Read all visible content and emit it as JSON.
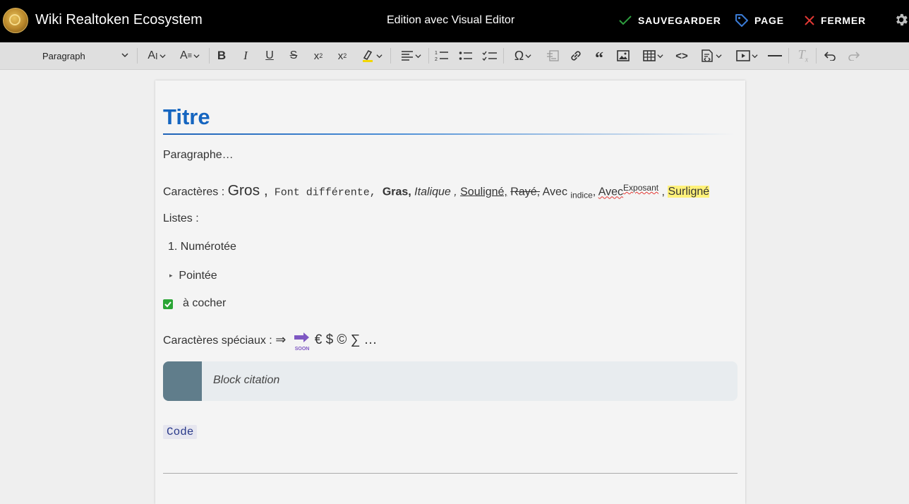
{
  "header": {
    "app_title": "Wiki Realtoken Ecosystem",
    "center_title": "Edition avec Visual Editor",
    "save_label": "SAUVEGARDER",
    "page_label": "PAGE",
    "close_label": "FERMER",
    "colors": {
      "bg": "#000000",
      "save_icon": "#2e9e3f",
      "page_icon": "#3a7bd5",
      "close_icon": "#e53935"
    }
  },
  "toolbar": {
    "paragraph_select": "Paragraph",
    "buttons": [
      "font-size",
      "text-style",
      "bold",
      "italic",
      "underline",
      "strikethrough",
      "subscript",
      "superscript",
      "highlight",
      "align",
      "ordered-list",
      "bullet-list",
      "task-list",
      "special-char",
      "template",
      "link",
      "blockquote",
      "image",
      "table",
      "code",
      "source",
      "media",
      "horizontal-rule",
      "clear-format",
      "undo",
      "redo"
    ]
  },
  "editor": {
    "heading": "Titre",
    "paragraph": "Paragraphe…",
    "chars_prefix": "Caractères : ",
    "chars_big": "Gros ,",
    "chars_font": " Font différente, ",
    "chars_bold": "Gras,",
    "chars_italic": " Italique ,",
    "chars_underline": "Souligné,",
    "chars_strike": "Rayé,",
    "chars_avec1": " Avec ",
    "chars_sub": "indice",
    "chars_comma": ", ",
    "chars_avec2": "Avec",
    "chars_sup": "Exposant",
    "chars_comma2": " , ",
    "chars_highlight": "Surligné",
    "lists_label": "Listes :",
    "numbered_item": "1. Numérotée",
    "bullet_marker": "▸",
    "bullet_item": "Pointée",
    "task_item": "à cocher",
    "special_prefix": "Caractères spéciaux : ",
    "special_arrow": "⇒",
    "special_soon": "SOON",
    "special_rest": "€ $ © ∑ …",
    "quote": "Block citation",
    "code": "Code"
  }
}
